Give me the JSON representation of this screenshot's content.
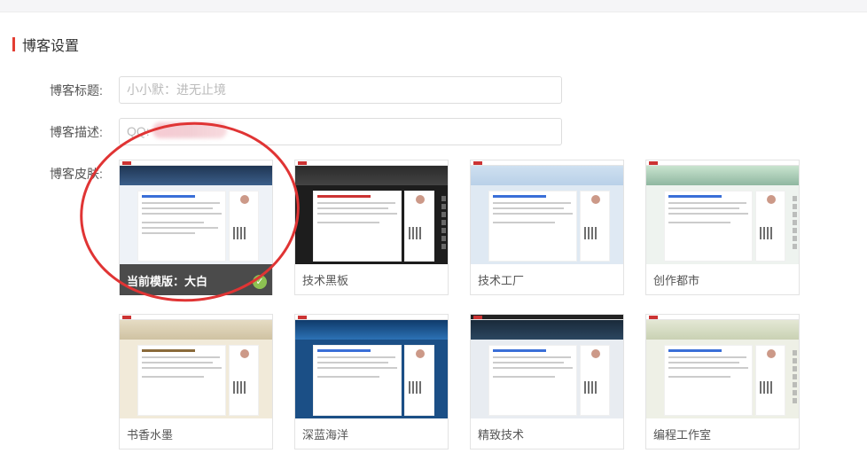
{
  "section_title": "博客设置",
  "fields": {
    "title": {
      "label": "博客标题:",
      "value": "小小默：进无止境"
    },
    "description": {
      "label": "博客描述:",
      "value": "QQ:"
    }
  },
  "skins_label": "博客皮肤:",
  "current_prefix": "当前模版：",
  "skins": [
    {
      "name": "大白",
      "current": true
    },
    {
      "name": "技术黑板",
      "current": false
    },
    {
      "name": "技术工厂",
      "current": false
    },
    {
      "name": "创作都市",
      "current": false
    },
    {
      "name": "书香水墨",
      "current": false
    },
    {
      "name": "深蓝海洋",
      "current": false
    },
    {
      "name": "精致技术",
      "current": false
    },
    {
      "name": "编程工作室",
      "current": false
    }
  ],
  "colors": {
    "accent": "#e33e33",
    "check": "#8dc152",
    "annotation_circle": "#e03434"
  }
}
